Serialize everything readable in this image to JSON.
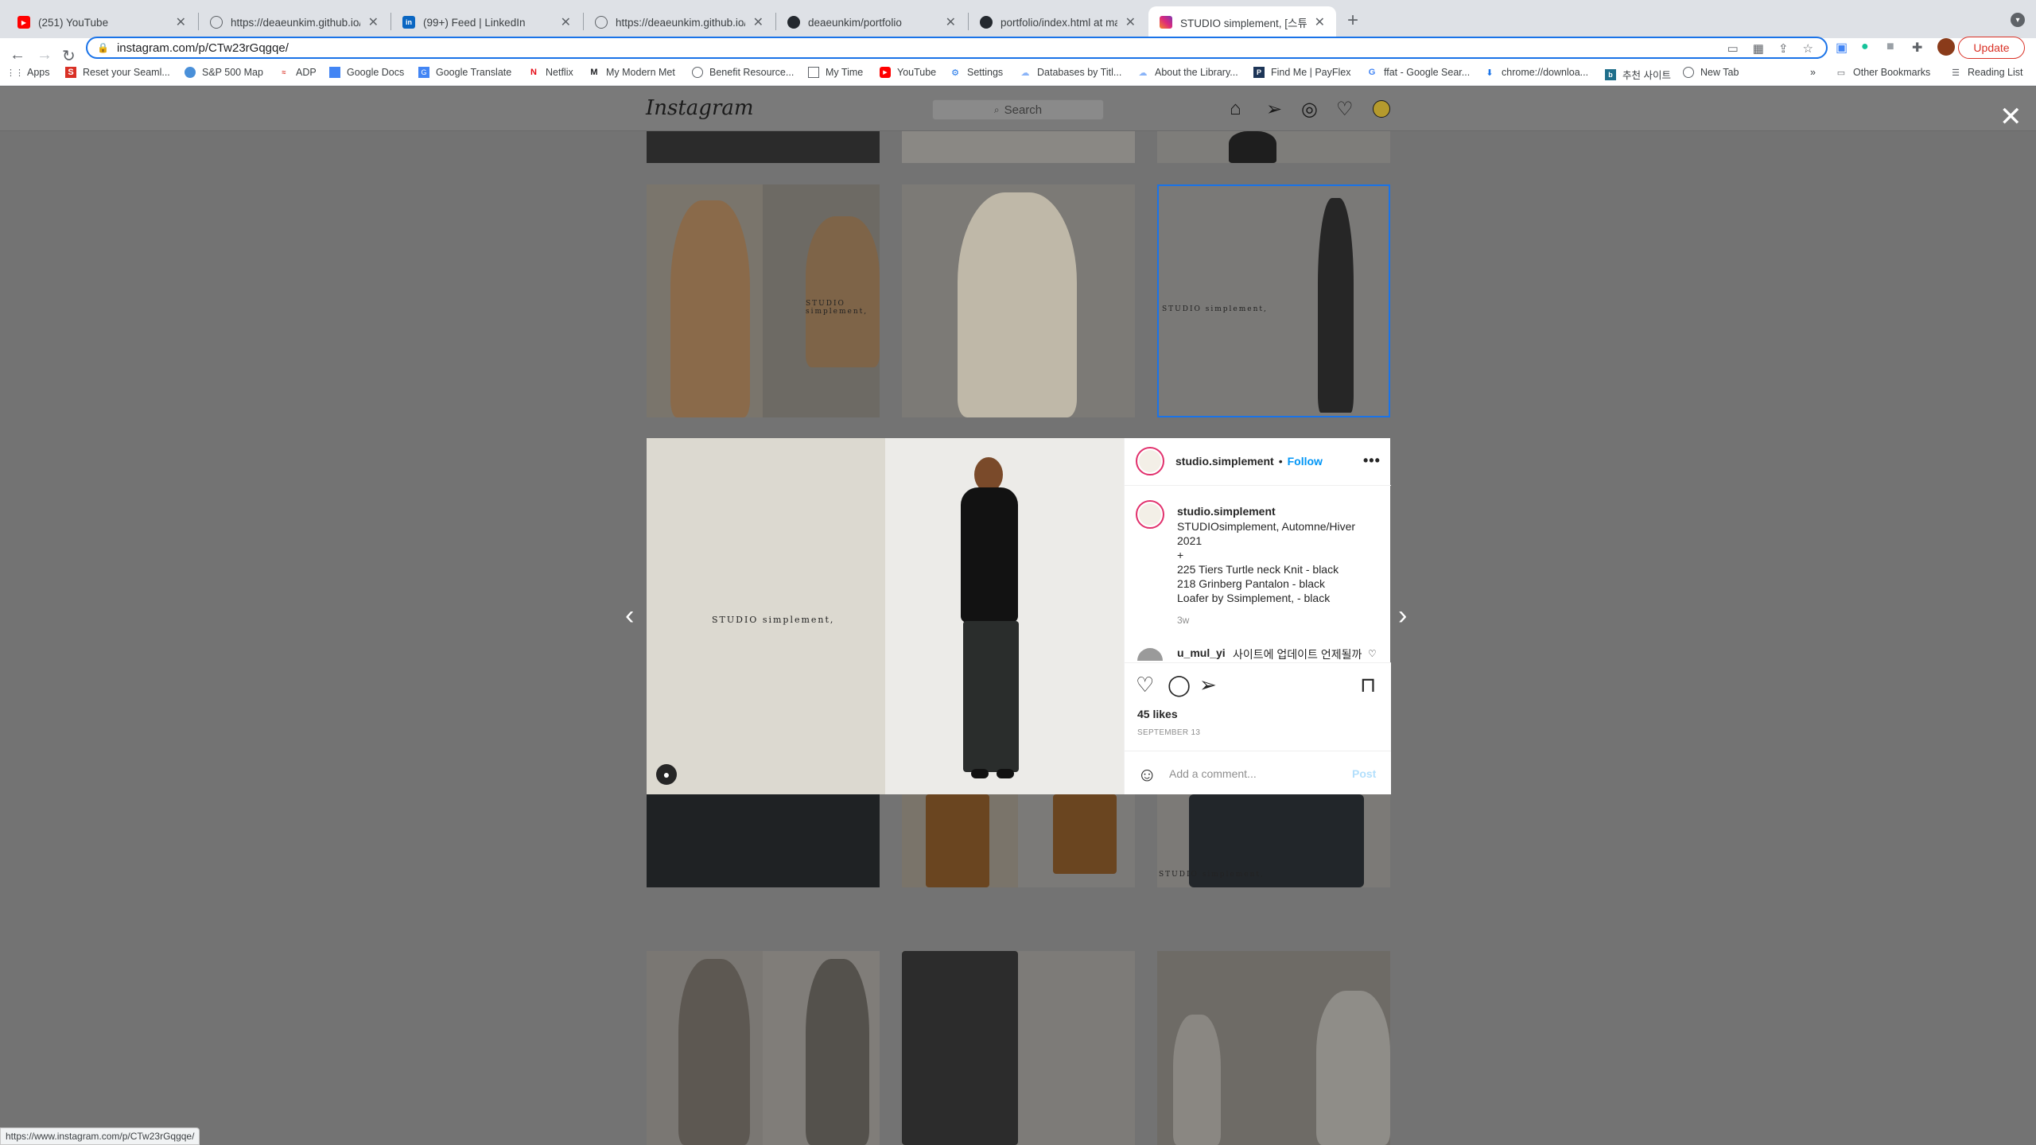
{
  "browser": {
    "tabs": [
      {
        "title": "(251) YouTube",
        "icon": "youtube-icon",
        "color": "#ff0000"
      },
      {
        "title": "https://deaeunkim.github.io/po",
        "icon": "globe-icon",
        "color": "#5f6368"
      },
      {
        "title": "(99+) Feed | LinkedIn",
        "icon": "linkedin-icon",
        "color": "#0a66c2"
      },
      {
        "title": "https://deaeunkim.github.io/po",
        "icon": "globe-icon",
        "color": "#5f6368"
      },
      {
        "title": "deaeunkim/portfolio",
        "icon": "github-icon",
        "color": "#24292f"
      },
      {
        "title": "portfolio/index.html at master",
        "icon": "github-icon",
        "color": "#24292f"
      },
      {
        "title": "STUDIO simplement, [스튜디오",
        "icon": "instagram-icon",
        "color": "#e1306c"
      }
    ],
    "url": "instagram.com/p/CTw23rGqgqe/",
    "update_label": "Update",
    "bookmarks": [
      {
        "label": "Apps",
        "icon": "apps-grid-icon"
      },
      {
        "label": "Reset your Seaml...",
        "icon": "seamless-icon"
      },
      {
        "label": "S&P 500 Map",
        "icon": "map-icon"
      },
      {
        "label": "ADP",
        "icon": "adp-icon"
      },
      {
        "label": "Google Docs",
        "icon": "docs-icon"
      },
      {
        "label": "Google Translate",
        "icon": "translate-icon"
      },
      {
        "label": "Netflix",
        "icon": "netflix-icon"
      },
      {
        "label": "My Modern Met",
        "icon": "mymodernmet-icon"
      },
      {
        "label": "Benefit Resource...",
        "icon": "globe-icon"
      },
      {
        "label": "My Time",
        "icon": "time-icon"
      },
      {
        "label": "YouTube",
        "icon": "youtube-icon"
      },
      {
        "label": "Settings",
        "icon": "settings-gear-icon"
      },
      {
        "label": "Databases by Titl...",
        "icon": "cloud-icon"
      },
      {
        "label": "About the Library...",
        "icon": "cloud-icon"
      },
      {
        "label": "Find Me | PayFlex",
        "icon": "payflex-icon"
      },
      {
        "label": "ffat - Google Sear...",
        "icon": "google-icon"
      },
      {
        "label": "chrome://downloa...",
        "icon": "download-icon"
      },
      {
        "label": "추천 사이트",
        "icon": "bookmark-b-icon"
      },
      {
        "label": "New Tab",
        "icon": "globe-icon"
      }
    ],
    "other_bookmarks": "Other Bookmarks",
    "reading_list": "Reading List",
    "status_url": "https://www.instagram.com/p/CTw23rGqgqe/"
  },
  "instagram": {
    "logo": "Instagram",
    "search_placeholder": "Search"
  },
  "post": {
    "image_caption": "STUDIO simplement,",
    "username": "studio.simplement",
    "follow_label": "Follow",
    "caption_lines": [
      "STUDIOsimplement, Automne/Hiver 2021",
      "+",
      "225 Tiers Turtle neck Knit - black",
      "218 Grinberg Pantalon - black",
      "Loafer by Ssimplement, - black"
    ],
    "time_ago": "3w",
    "comment_user": "u_mul_yi",
    "comment_text": "사이트에 업데이트 언제될까",
    "likes": "45 likes",
    "date": "SEPTEMBER 13",
    "add_comment_placeholder": "Add a comment...",
    "post_button": "Post"
  },
  "grid_captions": {
    "tile_a": "STUDIO simplement,",
    "tile_b": "STUDIO simplement,",
    "tile_c": "STUDIO simplement,"
  },
  "colors": {
    "accent_blue": "#0095f6",
    "omnibox_focus": "#1a73e8",
    "update_red": "#d93025"
  }
}
